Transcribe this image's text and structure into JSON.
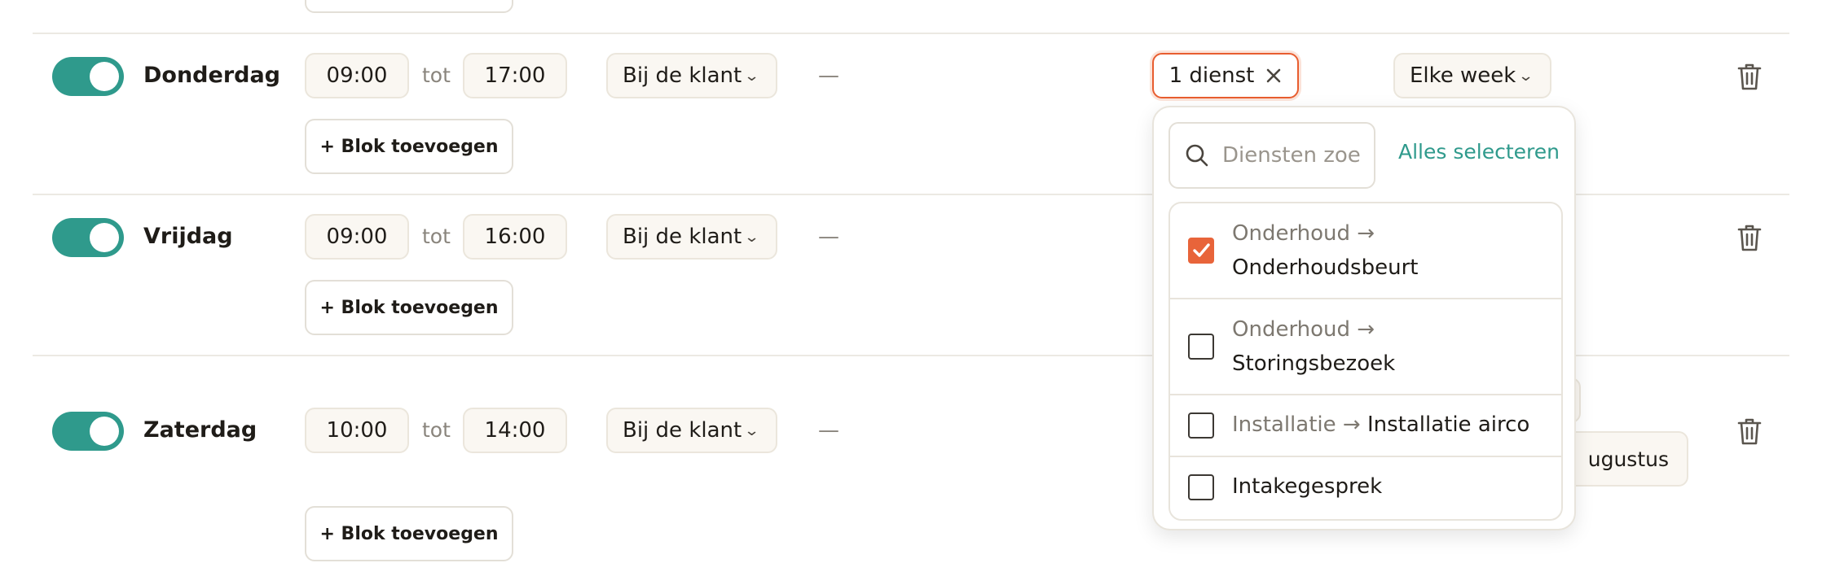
{
  "rows": [
    {
      "day": "Donderdag",
      "enabled": true,
      "start": "09:00",
      "sep": "tot",
      "end": "17:00",
      "location": "Bij de klant",
      "dash": "—"
    },
    {
      "day": "Vrijdag",
      "enabled": true,
      "start": "09:00",
      "sep": "tot",
      "end": "16:00",
      "location": "Bij de klant",
      "dash": "—"
    },
    {
      "day": "Zaterdag",
      "enabled": true,
      "start": "10:00",
      "sep": "tot",
      "end": "14:00",
      "location": "Bij de klant",
      "dash": "—"
    }
  ],
  "add_block_label": "+ Blok toevoegen",
  "services_button": {
    "label": "1 dienst",
    "clear_icon": "close-icon"
  },
  "recurrence": {
    "label": "Elke week"
  },
  "hidden_partial_text": "ugustus",
  "dropdown": {
    "search_placeholder": "Diensten zoeken",
    "select_all_label": "Alles selecteren",
    "items": [
      {
        "category": "Onderhoud →",
        "name": "Onderhoudsbeurt",
        "checked": true
      },
      {
        "category": "Onderhoud →",
        "name": "Storingsbezoek",
        "checked": false
      },
      {
        "category": "Installatie →",
        "name": "Installatie airco",
        "checked": false
      },
      {
        "category": "",
        "name": "Intakegesprek",
        "checked": false
      }
    ]
  },
  "colors": {
    "accent_teal": "#2f9a8c",
    "accent_orange": "#e8643a",
    "pill_bg": "#faf7f2"
  },
  "icons": {
    "delete": "trash-icon",
    "chevron": "chevron-down-icon",
    "search": "search-icon",
    "check": "check-icon"
  }
}
